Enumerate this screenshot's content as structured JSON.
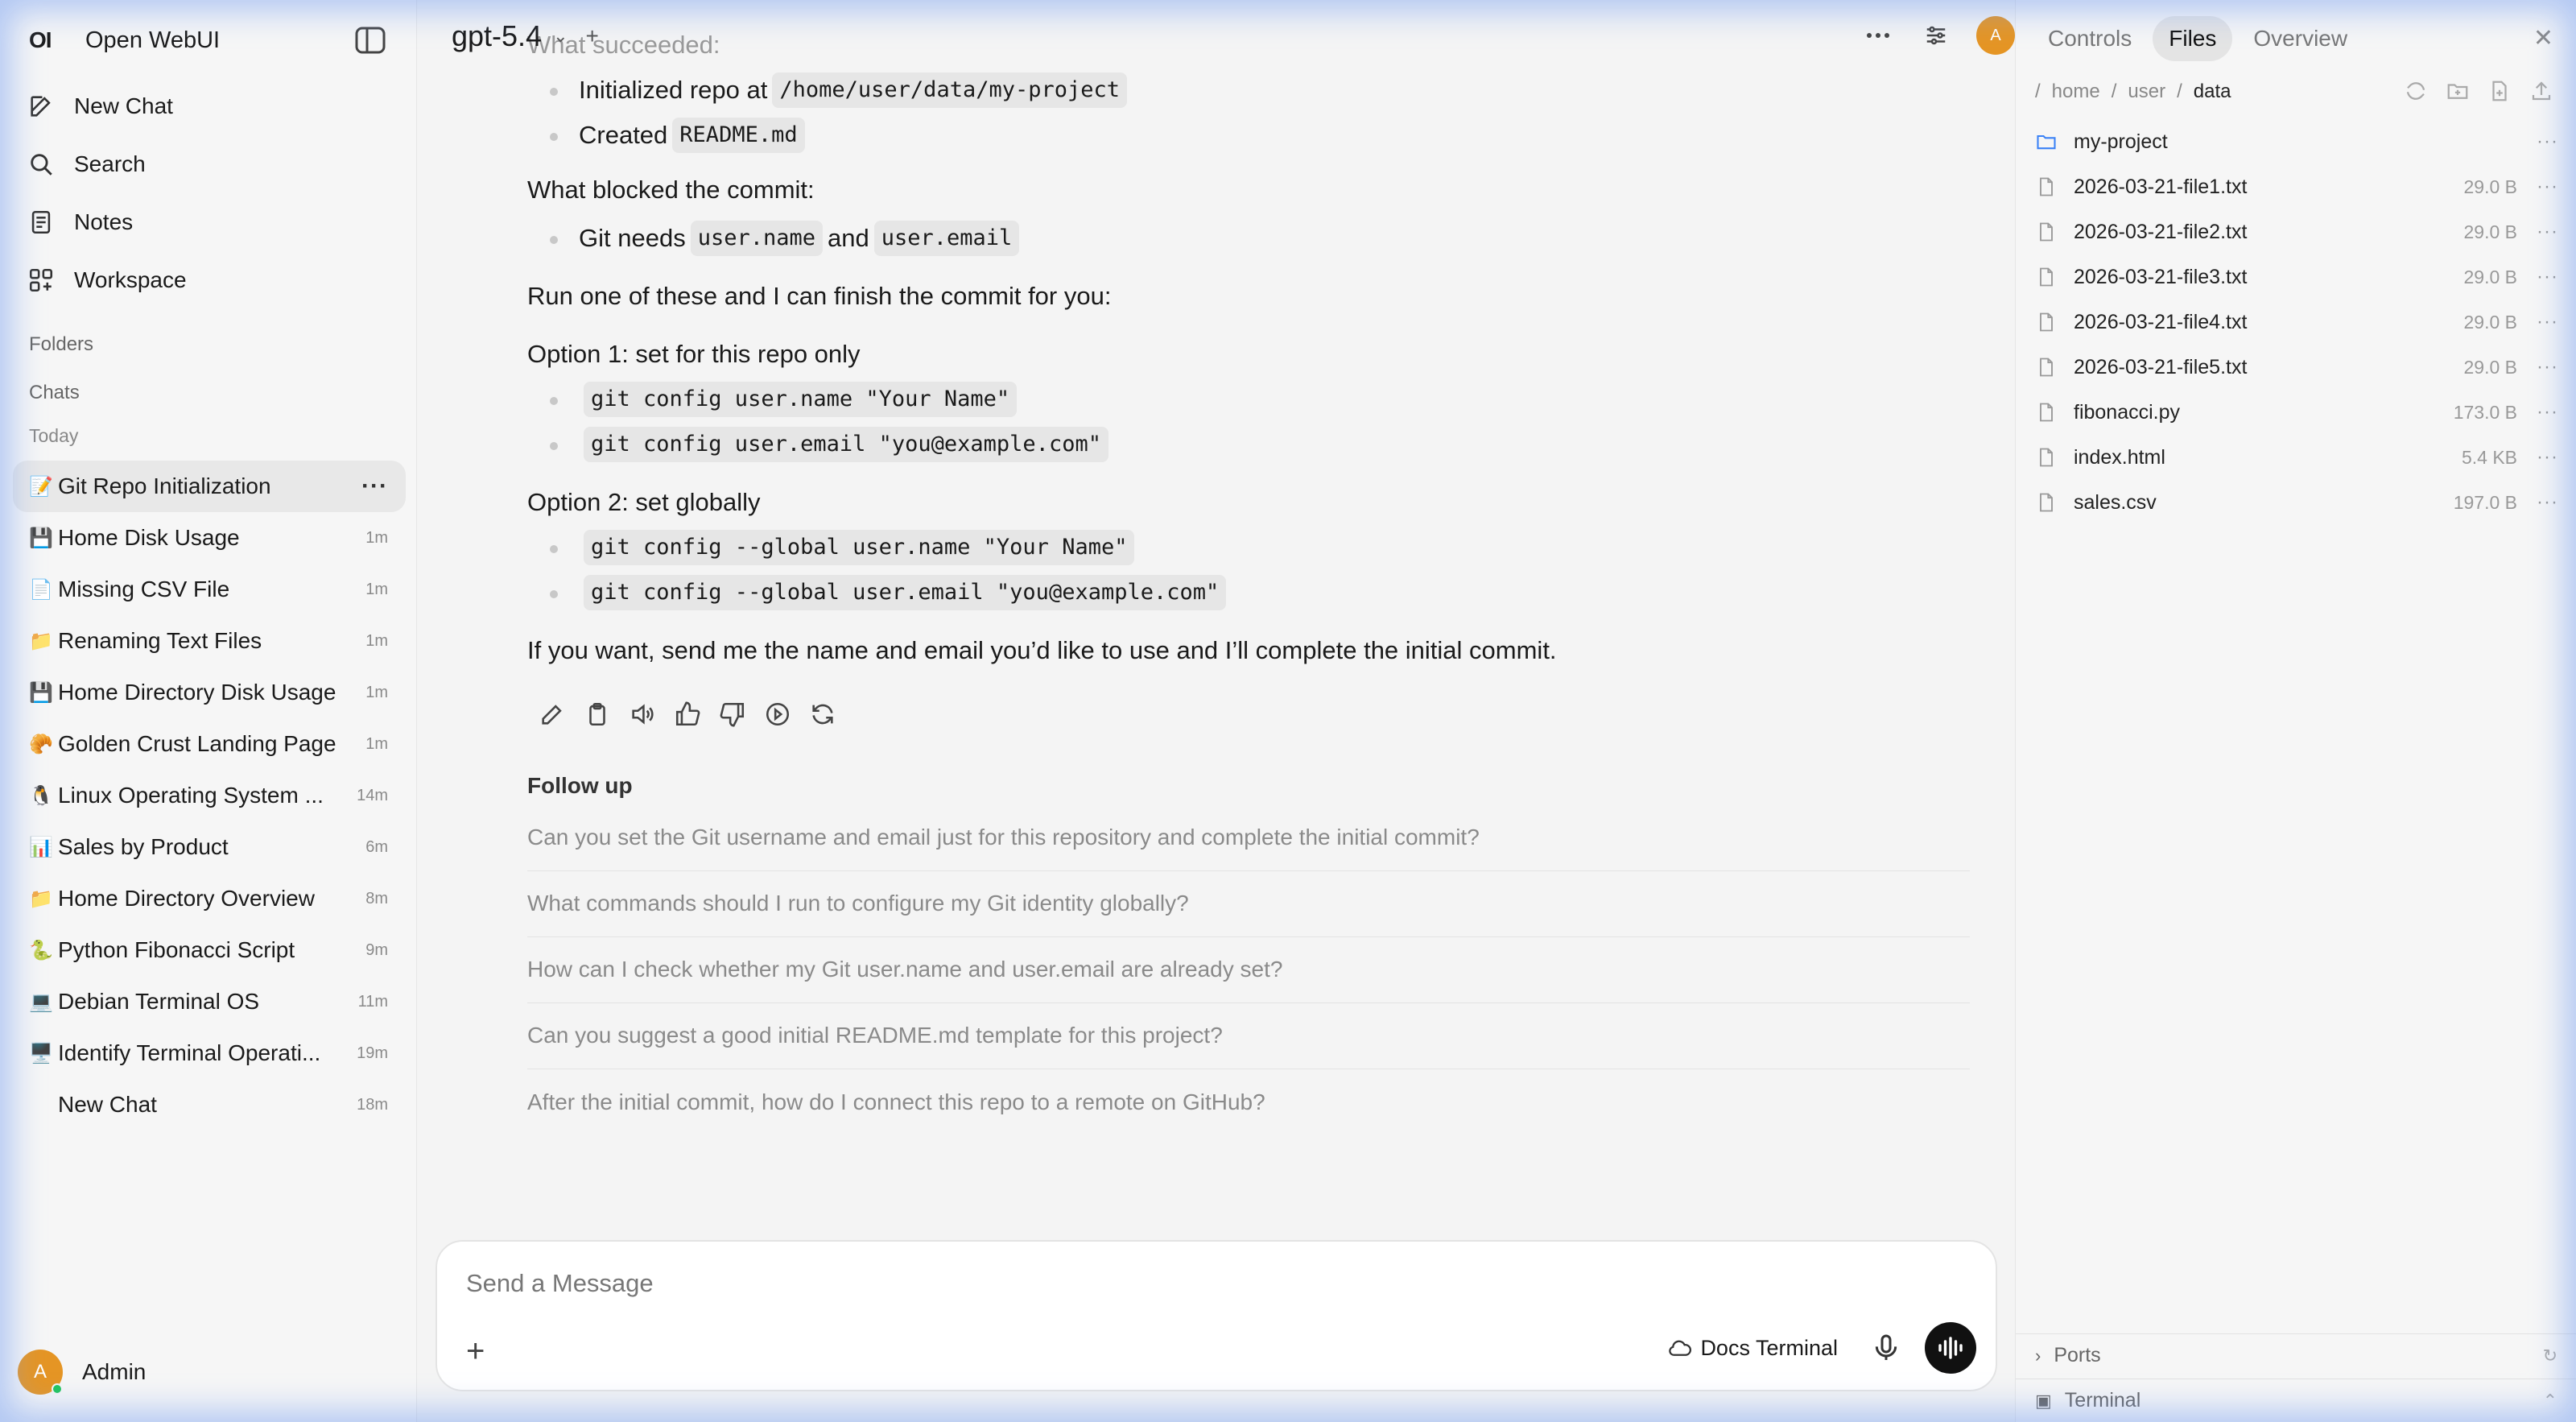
{
  "sidebar": {
    "logo": "OI",
    "app_name": "Open WebUI",
    "nav": {
      "new_chat": "New Chat",
      "search": "Search",
      "notes": "Notes",
      "workspace": "Workspace"
    },
    "folders_label": "Folders",
    "chats_label": "Chats",
    "today_label": "Today",
    "chats": [
      {
        "emoji": "📝",
        "title": "Git Repo Initialization",
        "time": "",
        "active": true
      },
      {
        "emoji": "💾",
        "title": "Home Disk Usage",
        "time": "1m"
      },
      {
        "emoji": "📄",
        "title": "Missing CSV File",
        "time": "1m"
      },
      {
        "emoji": "📁",
        "title": "Renaming Text Files",
        "time": "1m"
      },
      {
        "emoji": "💾",
        "title": "Home Directory Disk Usage",
        "time": "1m"
      },
      {
        "emoji": "🥐",
        "title": "Golden Crust Landing Page",
        "time": "1m"
      },
      {
        "emoji": "🐧",
        "title": "Linux Operating System ...",
        "time": "14m"
      },
      {
        "emoji": "📊",
        "title": "Sales by Product",
        "time": "6m"
      },
      {
        "emoji": "📁",
        "title": "Home Directory Overview",
        "time": "8m"
      },
      {
        "emoji": "🐍",
        "title": "Python Fibonacci Script",
        "time": "9m"
      },
      {
        "emoji": "💻",
        "title": "Debian Terminal OS",
        "time": "11m"
      },
      {
        "emoji": "🖥️",
        "title": "Identify Terminal Operati...",
        "time": "19m"
      },
      {
        "emoji": "",
        "title": "New Chat",
        "time": "18m"
      }
    ],
    "user": {
      "initial": "A",
      "name": "Admin"
    }
  },
  "main": {
    "model": "gpt-5.4",
    "avatar_initial": "A",
    "message": {
      "faded_heading": "What succeeded:",
      "succeeded": [
        {
          "text": "Initialized repo at",
          "code": "/home/user/data/my-project"
        },
        {
          "text": "Created",
          "code": "README.md"
        }
      ],
      "blocked_heading": "What blocked the commit:",
      "blocked_text_1": "Git needs",
      "blocked_code_1": "user.name",
      "blocked_and": "and",
      "blocked_code_2": "user.email",
      "run_one": "Run one of these and I can finish the commit for you:",
      "option1": "Option 1: set for this repo only",
      "option1_cmds": [
        "git config user.name \"Your Name\"",
        "git config user.email \"you@example.com\""
      ],
      "option2": "Option 2: set globally",
      "option2_cmds": [
        "git config --global user.name \"Your Name\"",
        "git config --global user.email \"you@example.com\""
      ],
      "closing": "If you want, send me the name and email you’d like to use and I’ll complete the initial commit."
    },
    "followup_heading": "Follow up",
    "followups": [
      "Can you set the Git username and email just for this repository and complete the initial commit?",
      "What commands should I run to configure my Git identity globally?",
      "How can I check whether my Git user.name and user.email are already set?",
      "Can you suggest a good initial README.md template for this project?",
      "After the initial commit, how do I connect this repo to a remote on GitHub?"
    ],
    "composer": {
      "placeholder": "Send a Message",
      "docs_terminal": "Docs Terminal"
    }
  },
  "panel": {
    "tabs": [
      "Controls",
      "Files",
      "Overview"
    ],
    "active_tab": "Files",
    "breadcrumb": [
      "home",
      "user",
      "data"
    ],
    "files": [
      {
        "name": "my-project",
        "size": "",
        "type": "folder"
      },
      {
        "name": "2026-03-21-file1.txt",
        "size": "29.0 B",
        "type": "file"
      },
      {
        "name": "2026-03-21-file2.txt",
        "size": "29.0 B",
        "type": "file"
      },
      {
        "name": "2026-03-21-file3.txt",
        "size": "29.0 B",
        "type": "file"
      },
      {
        "name": "2026-03-21-file4.txt",
        "size": "29.0 B",
        "type": "file"
      },
      {
        "name": "2026-03-21-file5.txt",
        "size": "29.0 B",
        "type": "file"
      },
      {
        "name": "fibonacci.py",
        "size": "173.0 B",
        "type": "file"
      },
      {
        "name": "index.html",
        "size": "5.4 KB",
        "type": "file"
      },
      {
        "name": "sales.csv",
        "size": "197.0 B",
        "type": "file"
      }
    ],
    "ports_label": "Ports",
    "terminal_label": "Terminal"
  },
  "colors": {
    "accent_avatar": "#e59524",
    "folder_icon": "#3b82f6"
  }
}
